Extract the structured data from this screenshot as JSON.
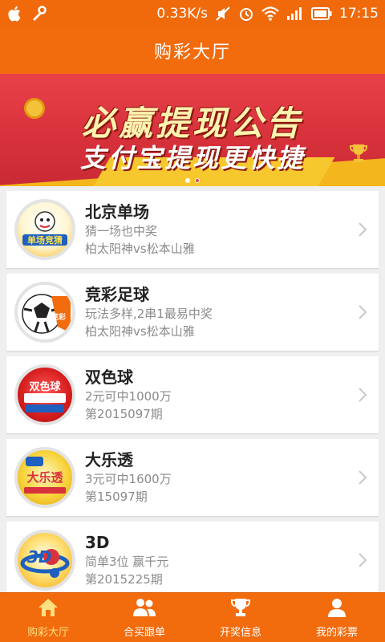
{
  "status_bar": {
    "speed": "0.33K/s",
    "time": "17:15"
  },
  "header": {
    "title": "购彩大厅"
  },
  "banner": {
    "headline": "必赢提现公告",
    "subline": "支付宝提现更快捷",
    "active_index": 1,
    "dot_count": 2
  },
  "lotteries": [
    {
      "name": "北京单场",
      "line1": "猜一场也中奖",
      "line2": "柏太阳神vs松本山雅",
      "logo": "beijing-danchang-logo",
      "logo_text": "单场竞猜"
    },
    {
      "name": "竞彩足球",
      "line1": "玩法多样,2串1最易中奖",
      "line2": "柏太阳神vs松本山雅",
      "logo": "soccer-ball-logo",
      "logo_text": "竞彩"
    },
    {
      "name": "双色球",
      "line1": "2元可中1000万",
      "line2": "第2015097期",
      "logo": "shuangseqiu-logo",
      "logo_text": "双色球"
    },
    {
      "name": "大乐透",
      "line1": "3元可中1600万",
      "line2": "第15097期",
      "logo": "daletou-logo",
      "logo_text": "大乐透"
    },
    {
      "name": "3D",
      "line1": "简单3位 赢千元",
      "line2": "第2015225期",
      "logo": "3d-logo",
      "logo_text": "3D"
    }
  ],
  "tabs": [
    {
      "label": "购彩大厅",
      "icon": "home-icon",
      "active": true
    },
    {
      "label": "合买跟单",
      "icon": "group-icon",
      "active": false
    },
    {
      "label": "开奖信息",
      "icon": "trophy-icon",
      "active": false
    },
    {
      "label": "我的彩票",
      "icon": "user-icon",
      "active": false
    }
  ],
  "colors": {
    "brand": "#f26b0d",
    "banner_red": "#d8323c",
    "active_tab": "#ffe080"
  }
}
